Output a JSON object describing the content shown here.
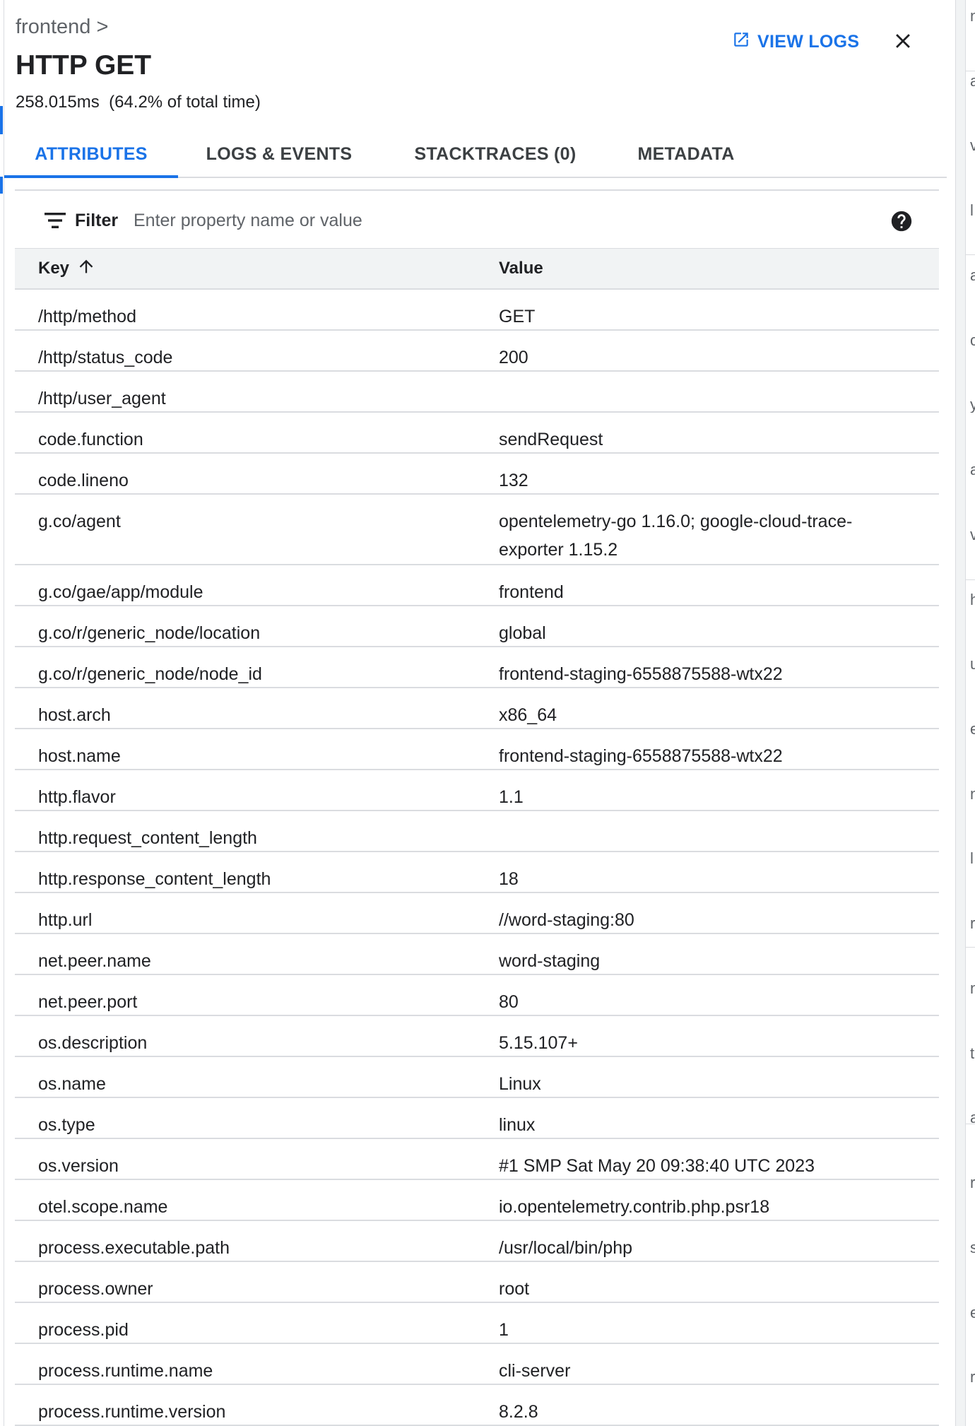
{
  "panel": {
    "breadcrumb": "frontend >",
    "title": "HTTP GET",
    "duration": "258.015ms  (64.2% of total time)",
    "view_logs_label": "VIEW LOGS",
    "view_logs_icon": "open-in-new-icon",
    "close_icon": "close-icon"
  },
  "tabs": [
    {
      "label": "ATTRIBUTES",
      "active": true
    },
    {
      "label": "LOGS & EVENTS",
      "active": false
    },
    {
      "label": "STACKTRACES (0)",
      "active": false
    },
    {
      "label": "METADATA",
      "active": false
    }
  ],
  "filter": {
    "label": "Filter",
    "placeholder": "Enter property name or value",
    "icon": "filter-list-icon",
    "help_icon": "help-circle-icon"
  },
  "table": {
    "headers": {
      "key": "Key",
      "value": "Value"
    },
    "sort_icon": "arrow-up-icon",
    "rows": [
      {
        "key": "/http/method",
        "value": "GET"
      },
      {
        "key": "/http/status_code",
        "value": "200"
      },
      {
        "key": "/http/user_agent",
        "value": ""
      },
      {
        "key": "code.function",
        "value": "sendRequest"
      },
      {
        "key": "code.lineno",
        "value": "132"
      },
      {
        "key": "g.co/agent",
        "value": "opentelemetry-go 1.16.0; google-cloud-trace-exporter 1.15.2"
      },
      {
        "key": "g.co/gae/app/module",
        "value": "frontend"
      },
      {
        "key": "g.co/r/generic_node/location",
        "value": "global"
      },
      {
        "key": "g.co/r/generic_node/node_id",
        "value": "frontend-staging-6558875588-wtx22"
      },
      {
        "key": "host.arch",
        "value": "x86_64"
      },
      {
        "key": "host.name",
        "value": "frontend-staging-6558875588-wtx22"
      },
      {
        "key": "http.flavor",
        "value": "1.1"
      },
      {
        "key": "http.request_content_length",
        "value": ""
      },
      {
        "key": "http.response_content_length",
        "value": "18"
      },
      {
        "key": "http.url",
        "value": "//word-staging:80"
      },
      {
        "key": "net.peer.name",
        "value": "word-staging"
      },
      {
        "key": "net.peer.port",
        "value": "80"
      },
      {
        "key": "os.description",
        "value": "5.15.107+"
      },
      {
        "key": "os.name",
        "value": "Linux"
      },
      {
        "key": "os.type",
        "value": "linux"
      },
      {
        "key": "os.version",
        "value": "#1 SMP Sat May 20 09:38:40 UTC 2023"
      },
      {
        "key": "otel.scope.name",
        "value": "io.opentelemetry.contrib.php.psr18"
      },
      {
        "key": "process.executable.path",
        "value": "/usr/local/bin/php"
      },
      {
        "key": "process.owner",
        "value": "root"
      },
      {
        "key": "process.pid",
        "value": "1"
      },
      {
        "key": "process.runtime.name",
        "value": "cli-server"
      },
      {
        "key": "process.runtime.version",
        "value": "8.2.8"
      }
    ]
  },
  "background": {
    "right_glyphs": [
      "n",
      "a",
      "v",
      "l",
      "a",
      "c",
      "y",
      "a",
      "v",
      "h",
      "u",
      "e",
      "n",
      "l",
      "r",
      "n",
      "t",
      "a",
      "r",
      "s",
      "e",
      "r"
    ]
  },
  "colors": {
    "accent": "#1a73e8",
    "text": "#202124",
    "muted": "#5f6368",
    "divider": "#dadce0",
    "header_bg": "#f1f3f4"
  }
}
